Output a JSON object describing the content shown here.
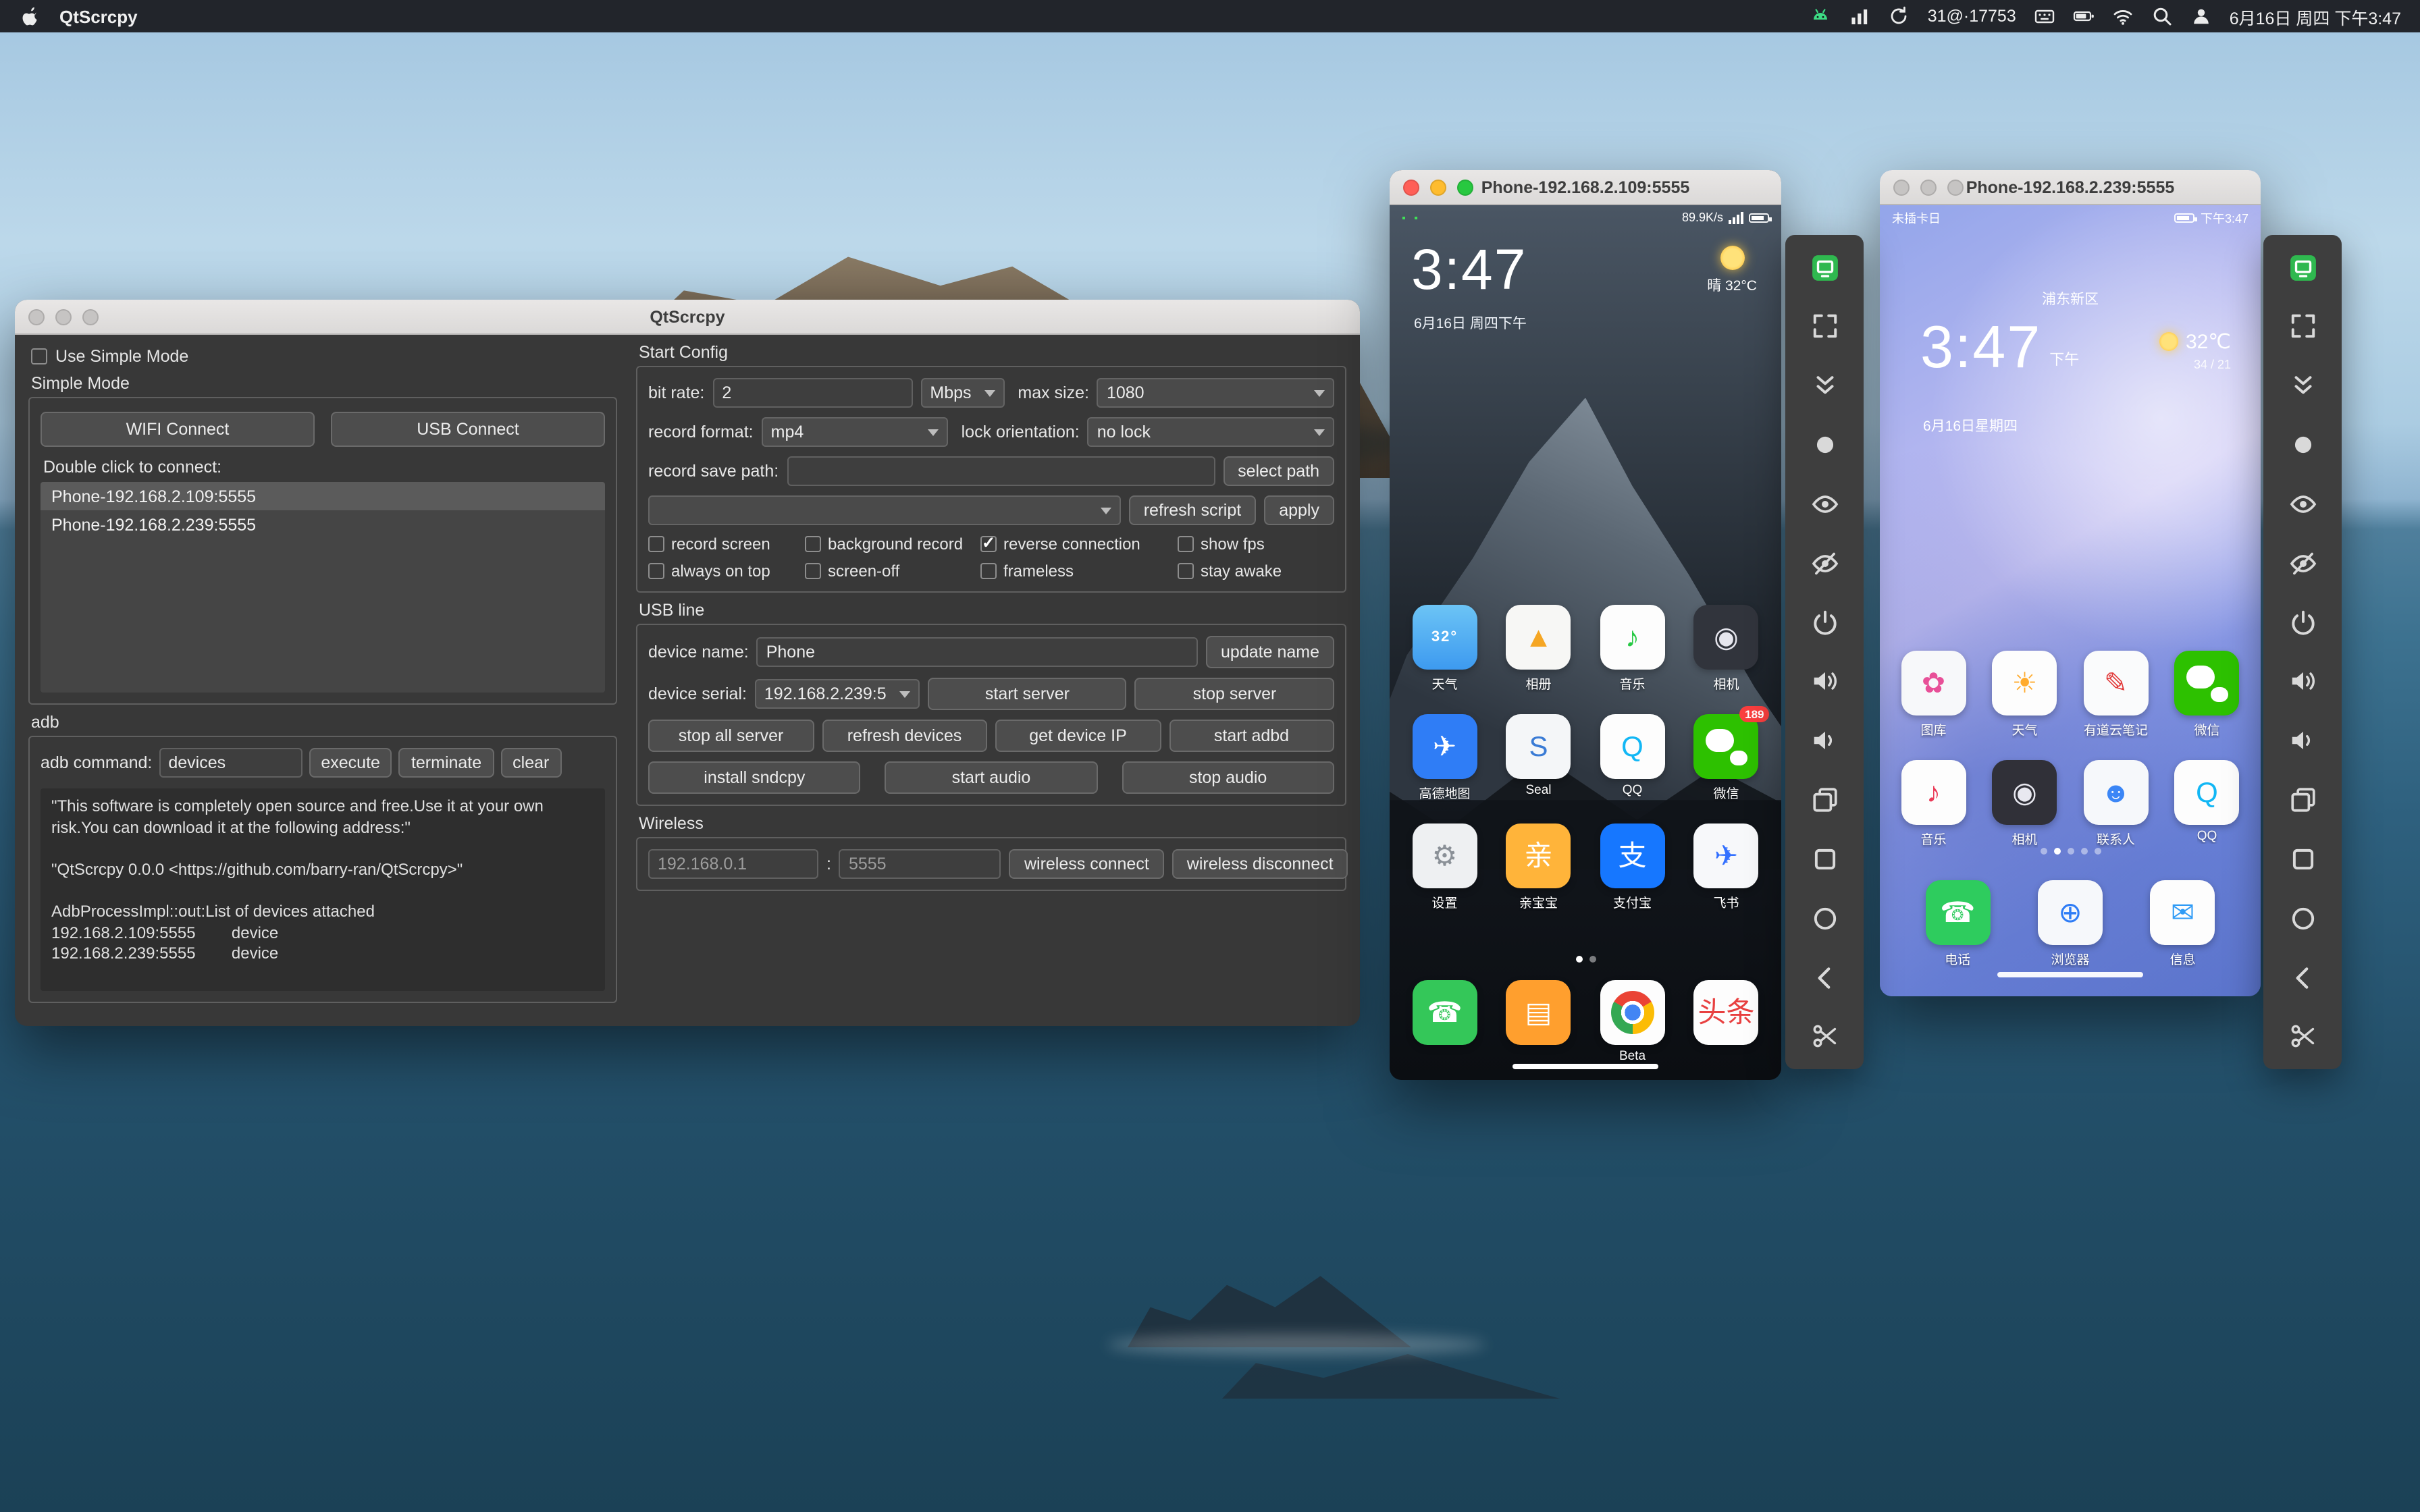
{
  "menu_bar": {
    "app_name": "QtScrcpy",
    "icons_left_group": [
      "android-icon",
      "meter-icon",
      "sync-icon"
    ],
    "status_counter": "31@·17753",
    "icons_right_group": [
      "keyboard-icon",
      "battery-icon",
      "wifi-icon",
      "spotlight-icon",
      "user-icon"
    ],
    "clock": "6月16日 周四 下午3:47"
  },
  "main_window": {
    "title": "QtScrcpy",
    "use_simple_mode_label": "Use Simple Mode",
    "simple_mode_group": "Simple Mode",
    "wifi_connect": "WIFI Connect",
    "usb_connect": "USB Connect",
    "double_click_label": "Double click to connect:",
    "devices": [
      "Phone-192.168.2.109:5555",
      "Phone-192.168.2.239:5555"
    ],
    "adb_group": "adb",
    "adb_command_label": "adb command:",
    "adb_command_value": "devices",
    "execute_btn": "execute",
    "terminate_btn": "terminate",
    "clear_btn": "clear",
    "log_text": "\"This software is completely open source and free.Use it at your own risk.You can download it at the following address:\"\n\n\"QtScrcpy 0.0.0 <https://github.com/barry-ran/QtScrcpy>\"\n\nAdbProcessImpl::out:List of devices attached\n192.168.2.109:5555        device\n192.168.2.239:5555        device",
    "start_config": {
      "group_title": "Start Config",
      "bit_rate_label": "bit rate:",
      "bit_rate_value": "2",
      "bit_rate_unit": "Mbps",
      "max_size_label": "max size:",
      "max_size_value": "1080",
      "record_format_label": "record format:",
      "record_format_value": "mp4",
      "lock_orientation_label": "lock orientation:",
      "lock_orientation_value": "no lock",
      "record_save_path_label": "record save path:",
      "record_save_path_value": "",
      "select_path_btn": "select path",
      "script_combo_value": "",
      "refresh_script_btn": "refresh script",
      "apply_btn": "apply",
      "checkboxes": [
        {
          "label": "record screen",
          "checked": false
        },
        {
          "label": "background record",
          "checked": false
        },
        {
          "label": "reverse connection",
          "checked": true
        },
        {
          "label": "show fps",
          "checked": false
        },
        {
          "label": "always on top",
          "checked": false
        },
        {
          "label": "screen-off",
          "checked": false
        },
        {
          "label": "frameless",
          "checked": false
        },
        {
          "label": "stay awake",
          "checked": false
        }
      ]
    },
    "usb_line": {
      "group_title": "USB line",
      "device_name_label": "device name:",
      "device_name_value": "Phone",
      "update_name_btn": "update name",
      "device_serial_label": "device serial:",
      "device_serial_value": "192.168.2.239:5",
      "start_server_btn": "start server",
      "stop_server_btn": "stop server",
      "row3_buttons": [
        "stop all server",
        "refresh devices",
        "get device IP",
        "start adbd"
      ],
      "row4_buttons": [
        "install sndcpy",
        "start audio",
        "stop audio"
      ]
    },
    "wireless": {
      "group_title": "Wireless",
      "ip_value": "192.168.0.1",
      "separator": ":",
      "port_value": "5555",
      "connect_btn": "wireless connect",
      "disconnect_btn": "wireless disconnect"
    }
  },
  "toolbar": {
    "icons": [
      "app-logo-icon",
      "fullscreen-icon",
      "collapse-icon",
      "record-dot-icon",
      "eye-icon",
      "eye-off-icon",
      "power-icon",
      "volume-up-icon",
      "volume-down-icon",
      "app-switch-icon",
      "menu-square-icon",
      "home-circle-icon",
      "back-icon",
      "scissors-icon"
    ]
  },
  "phone1": {
    "title": "Phone-192.168.2.109:5555",
    "status_left": "▪ ▪",
    "status_right": "89.9K/s",
    "clock": "3:47",
    "date": "6月16日 周四下午",
    "weather": "晴 32°C",
    "apps": [
      {
        "name": "weather",
        "label": "天气",
        "glyph": "32°",
        "fg": "#ffffff",
        "bg": "linear-gradient(180deg,#6cc4f5,#3d9af0)"
      },
      {
        "name": "gallery",
        "label": "相册",
        "glyph": "▲",
        "fg": "#f5a623",
        "bg": "#f7f7f5"
      },
      {
        "name": "music",
        "label": "音乐",
        "glyph": "♪",
        "fg": "#26c944",
        "bg": "#fdfdfd"
      },
      {
        "name": "camera",
        "label": "相机",
        "glyph": "◉",
        "fg": "#e6e6ee",
        "bg": "#31343c"
      },
      {
        "name": "amap",
        "label": "高德地图",
        "glyph": "✈",
        "fg": "#ffffff",
        "bg": "#2f7df6"
      },
      {
        "name": "seal",
        "label": "Seal",
        "glyph": "S",
        "fg": "#3a7bd5",
        "bg": "#f4f6f8"
      },
      {
        "name": "qq",
        "label": "QQ",
        "glyph": "Q",
        "fg": "#12b7f5",
        "bg": "#fdfdfd"
      },
      {
        "name": "wechat",
        "label": "微信",
        "cls": "gi-wechat",
        "bg": "#2dc100",
        "badge": "189"
      },
      {
        "name": "settings",
        "label": "设置",
        "glyph": "⚙",
        "fg": "#8a9097",
        "bg": "#eef0f2"
      },
      {
        "name": "qinbaobao",
        "label": "亲宝宝",
        "glyph": "亲",
        "fg": "#ffffff",
        "bg": "#ffb43a"
      },
      {
        "name": "alipay",
        "label": "支付宝",
        "glyph": "支",
        "fg": "#ffffff",
        "bg": "#1677ff"
      },
      {
        "name": "feishu",
        "label": "飞书",
        "glyph": "✈",
        "fg": "#3370ff",
        "bg": "#f7f8fa"
      }
    ],
    "dock": [
      {
        "name": "phone",
        "glyph": "☎",
        "fg": "#ffffff",
        "bg": "#34c759"
      },
      {
        "name": "files",
        "glyph": "▤",
        "fg": "#ffffff",
        "bg": "#ff9f2e"
      },
      {
        "name": "chrome",
        "label": "Beta",
        "cls": "gi-chrome",
        "bg": "#fdfdfd"
      },
      {
        "name": "toutiao",
        "glyph": "头条",
        "fg": "#e84040",
        "bg": "#fdfdfd"
      }
    ],
    "dots": [
      true,
      false
    ]
  },
  "phone2": {
    "title": "Phone-192.168.2.239:5555",
    "status_left": "未插卡日",
    "status_right": "下午3:47",
    "location": "浦东新区",
    "clock": "3:47",
    "ampm": "下午",
    "weather_temp": "32℃",
    "weather_range": "34 / 21",
    "date": "6月16日星期四",
    "apps": [
      {
        "name": "gallery",
        "label": "图库",
        "glyph": "✿",
        "fg": "#e85098",
        "bg": "#f7f8fa"
      },
      {
        "name": "weather",
        "label": "天气",
        "glyph": "☀",
        "fg": "#ffab2e",
        "bg": "#fdfdfd"
      },
      {
        "name": "youdao-note",
        "label": "有道云笔记",
        "glyph": "✎",
        "fg": "#e23b3b",
        "bg": "#fafbfc"
      },
      {
        "name": "wechat",
        "label": "微信",
        "cls": "gi-wechat",
        "bg": "#2dc100"
      },
      {
        "name": "music",
        "label": "音乐",
        "glyph": "♪",
        "fg": "#ea3b58",
        "bg": "#fdfdfd"
      },
      {
        "name": "camera",
        "label": "相机",
        "glyph": "◉",
        "fg": "#e8e8f0",
        "bg": "#303038"
      },
      {
        "name": "contacts",
        "label": "联系人",
        "glyph": "☻",
        "fg": "#3b86f6",
        "bg": "#f6f8fb"
      },
      {
        "name": "qq",
        "label": "QQ",
        "glyph": "Q",
        "fg": "#12b7f5",
        "bg": "#fdfdfd"
      }
    ],
    "dock": [
      {
        "name": "phone",
        "label": "电话",
        "glyph": "☎",
        "fg": "#ffffff",
        "bg": "#2ecc5e"
      },
      {
        "name": "browser",
        "label": "浏览器",
        "glyph": "⊕",
        "fg": "#2f7df6",
        "bg": "#f6f8fb"
      },
      {
        "name": "messages",
        "label": "信息",
        "glyph": "✉",
        "fg": "#2f9bf6",
        "bg": "#fdfdfd"
      }
    ],
    "dots": [
      false,
      true,
      false,
      false,
      false
    ]
  }
}
